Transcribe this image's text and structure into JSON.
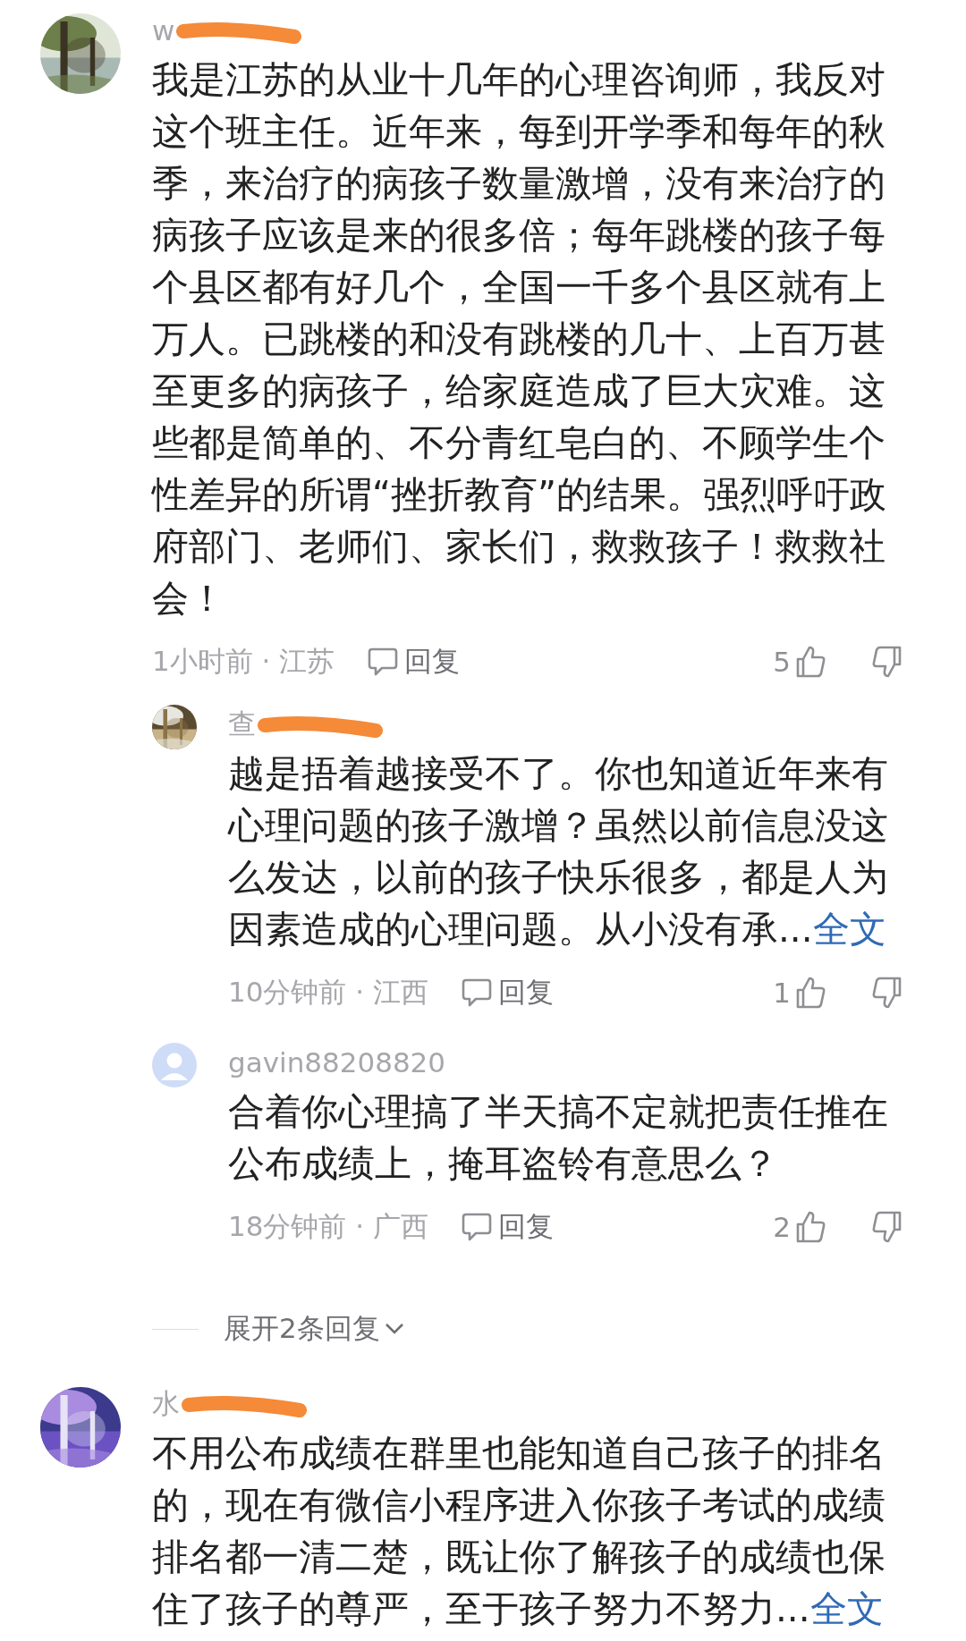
{
  "comments": [
    {
      "username": "w",
      "redacted": true,
      "text": "我是江苏的从业十几年的心理咨询师，我反对这个班主任。近年来，每到开学季和每年的秋季，来治疗的病孩子数量激增，没有来治疗的病孩子应该是来的很多倍；每年跳楼的孩子每个县区都有好几个，全国一千多个县区就有上万人。已跳楼的和没有跳楼的几十、上百万甚至更多的病孩子，给家庭造成了巨大灾难。这些都是简单的、不分青红皂白的、不顾学生个性差异的所谓“挫折教育”的结果。强烈呼吁政府部门、老师们、家长们，救救孩子！救救社会！",
      "meta": "1小时前 · 江苏",
      "reply_label": "回复",
      "likes": "5",
      "replies": [
        {
          "username": "查",
          "redacted": true,
          "text": "越是捂着越接受不了。你也知道近年来有心理问题的孩子激增？虽然以前信息没这么发达，以前的孩子快乐很多，都是人为因素造成的心理问题。从小没有承...",
          "more_link": "全文",
          "meta": "10分钟前 · 江西",
          "reply_label": "回复",
          "likes": "1"
        },
        {
          "username": "gavin88208820",
          "redacted": false,
          "avatar": {
            "kind": "default"
          },
          "text": "合着你心理搞了半天搞不定就把责任推在公布成绩上，掩耳盗铃有意思么？",
          "meta": "18分钟前 · 广西",
          "reply_label": "回复",
          "likes": "2"
        }
      ],
      "expand_label": "展开2条回复"
    },
    {
      "username": "水",
      "redacted": true,
      "text": "不用公布成绩在群里也能知道自己孩子的排名的，现在有微信小程序进入你孩子考试的成绩排名都一清二楚，既让你了解孩子的成绩也保住了孩子的尊严，至于孩子努力不努力...",
      "more_link": "全文"
    }
  ]
}
